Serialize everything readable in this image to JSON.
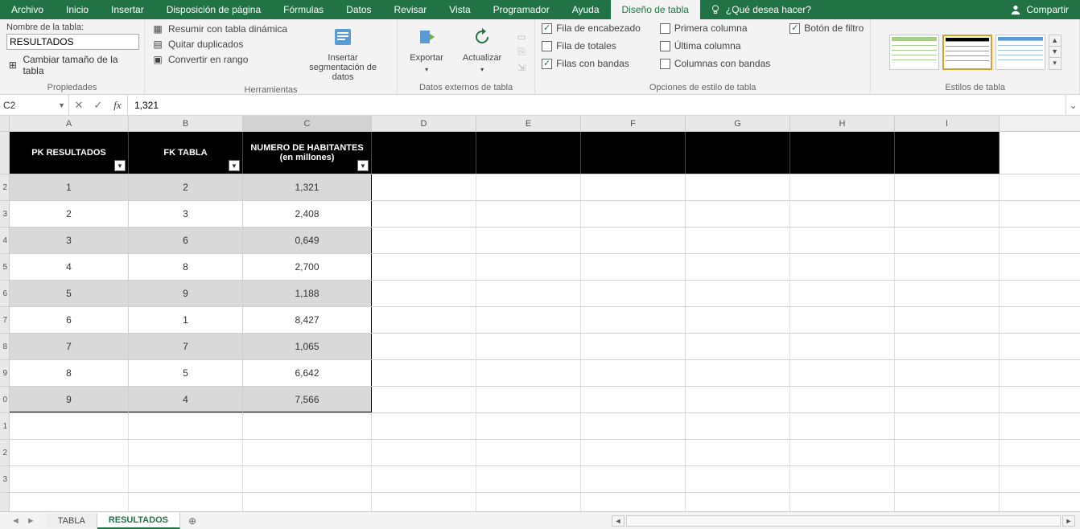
{
  "ribbon": {
    "tabs": [
      "Archivo",
      "Inicio",
      "Insertar",
      "Disposición de página",
      "Fórmulas",
      "Datos",
      "Revisar",
      "Vista",
      "Programador",
      "Ayuda",
      "Diseño de tabla"
    ],
    "active_tab": "Diseño de tabla",
    "tell_me_placeholder": "¿Qué desea hacer?",
    "share": "Compartir"
  },
  "groups": {
    "properties": {
      "label": "Propiedades",
      "table_name_label": "Nombre de la tabla:",
      "table_name_value": "RESULTADOS",
      "resize": "Cambiar tamaño de la tabla"
    },
    "tools": {
      "label": "Herramientas",
      "pivot": "Resumir con tabla dinámica",
      "dedup": "Quitar duplicados",
      "convert": "Convertir en rango",
      "slicer": "Insertar segmentación de datos"
    },
    "external": {
      "label": "Datos externos de tabla",
      "export": "Exportar",
      "refresh": "Actualizar"
    },
    "style_opts": {
      "label": "Opciones de estilo de tabla",
      "header_row": "Fila de encabezado",
      "total_row": "Fila de totales",
      "banded_rows": "Filas con bandas",
      "first_col": "Primera columna",
      "last_col": "Última columna",
      "banded_cols": "Columnas con bandas",
      "filter_btn": "Botón de filtro"
    },
    "styles": {
      "label": "Estilos de tabla"
    }
  },
  "fxbar": {
    "namebox": "C2",
    "formula": "1,321"
  },
  "columns": [
    "A",
    "B",
    "C",
    "D",
    "E",
    "F",
    "G",
    "H",
    "I"
  ],
  "rows_visible": [
    "",
    "2",
    "3",
    "4",
    "5",
    "6",
    "7",
    "8",
    "9",
    "0",
    "1",
    "2",
    "3"
  ],
  "table": {
    "headers": [
      "PK RESULTADOS",
      "FK TABLA",
      "NUMERO DE HABITANTES (en millones)"
    ],
    "rows": [
      {
        "pk": "1",
        "fk": "2",
        "hab": "1,321"
      },
      {
        "pk": "2",
        "fk": "3",
        "hab": "2,408"
      },
      {
        "pk": "3",
        "fk": "6",
        "hab": "0,649"
      },
      {
        "pk": "4",
        "fk": "8",
        "hab": "2,700"
      },
      {
        "pk": "5",
        "fk": "9",
        "hab": "1,188"
      },
      {
        "pk": "6",
        "fk": "1",
        "hab": "8,427"
      },
      {
        "pk": "7",
        "fk": "7",
        "hab": "1,065"
      },
      {
        "pk": "8",
        "fk": "5",
        "hab": "6,642"
      },
      {
        "pk": "9",
        "fk": "4",
        "hab": "7,566"
      }
    ]
  },
  "sheets": {
    "tabs": [
      "TABLA",
      "RESULTADOS"
    ],
    "active": "RESULTADOS"
  }
}
